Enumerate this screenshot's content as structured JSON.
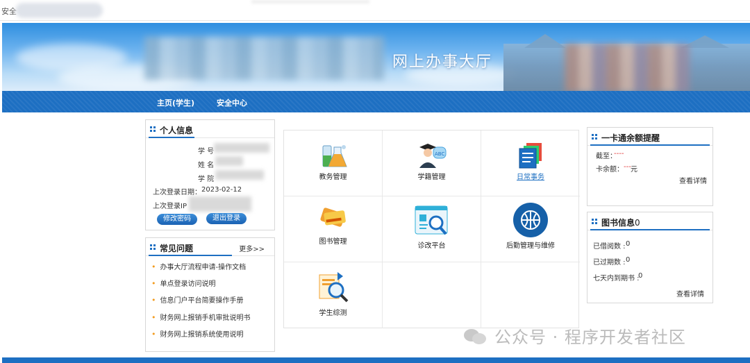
{
  "browser": {
    "security_text": "安全"
  },
  "banner": {
    "title": "网上办事大厅"
  },
  "nav": [
    {
      "label": "主页(学生)"
    },
    {
      "label": "安全中心"
    }
  ],
  "personal": {
    "title": "个人信息",
    "student_id_label": "学 号",
    "name_label": "姓 名",
    "college_label": "学 院",
    "last_login_date_label": "上次登录日期：",
    "last_login_date": "2023-02-12",
    "last_login_ip_label": "上次登录IP",
    "change_password": "修改密码",
    "logout": "退出登录"
  },
  "faq": {
    "title": "常见问题",
    "more": "更多>>",
    "items": [
      "办事大厅流程申请-操作文档",
      "单点登录访问说明",
      "信息门户平台简要操作手册",
      "财务网上报销手机审批说明书",
      "财务网上报销系统使用说明"
    ]
  },
  "apps": [
    {
      "label": "教务管理",
      "icon": "chemistry-flask-icon"
    },
    {
      "label": "学籍管理",
      "icon": "graduate-student-icon"
    },
    {
      "label": "日常事务",
      "icon": "documents-stack-icon"
    },
    {
      "label": "图书管理",
      "icon": "library-card-icon"
    },
    {
      "label": "诊改平台",
      "icon": "magnifier-report-icon"
    },
    {
      "label": "后勤管理与维修",
      "icon": "basketball-circle-icon"
    },
    {
      "label": "学生综测",
      "icon": "search-document-icon"
    }
  ],
  "card": {
    "title": "一卡通余额提醒",
    "as_of_label": "截至：",
    "as_of_value": "----",
    "balance_label": "卡余额：",
    "balance_value": "---",
    "balance_unit": "元",
    "details": "查看详情"
  },
  "library": {
    "title": "图书信息",
    "title_suffix": "0",
    "borrowed_label": "已借阅数 :",
    "borrowed": "0",
    "overdue_label": "已过期数 :",
    "overdue": "0",
    "due_soon_label": "七天内到期书 :",
    "due_soon": "0",
    "details": "查看详情"
  },
  "watermark": {
    "text": "公众号 · 程序开发者社区"
  },
  "colors": {
    "primary": "#1d6fc2",
    "bullet": "#f29b1f",
    "alert": "#e03030"
  }
}
